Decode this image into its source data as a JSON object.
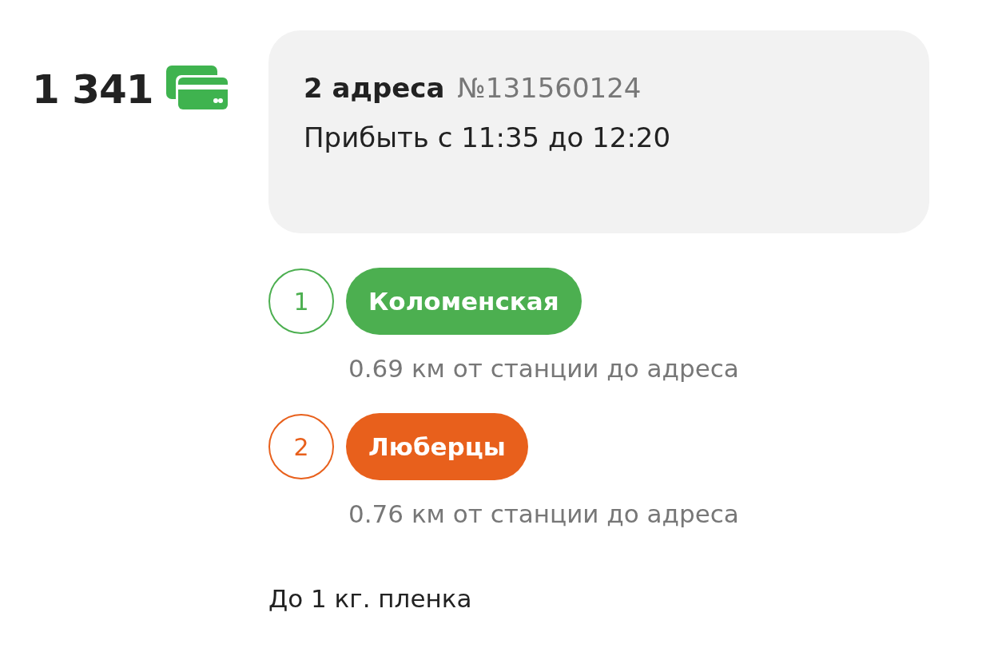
{
  "price": "1 341",
  "order": {
    "addresses": "2 адреса",
    "number": "№131560124",
    "arrival": "Прибыть с 11:35 до 12:20"
  },
  "stops": [
    {
      "index": "1",
      "station": "Коломенская",
      "color": "#4caf50",
      "distance": "0.69 км от станции до адреса"
    },
    {
      "index": "2",
      "station": "Люберцы",
      "color": "#e8601c",
      "distance": "0.76 км от станции до адреса"
    }
  ],
  "note": "До 1 кг. пленка"
}
